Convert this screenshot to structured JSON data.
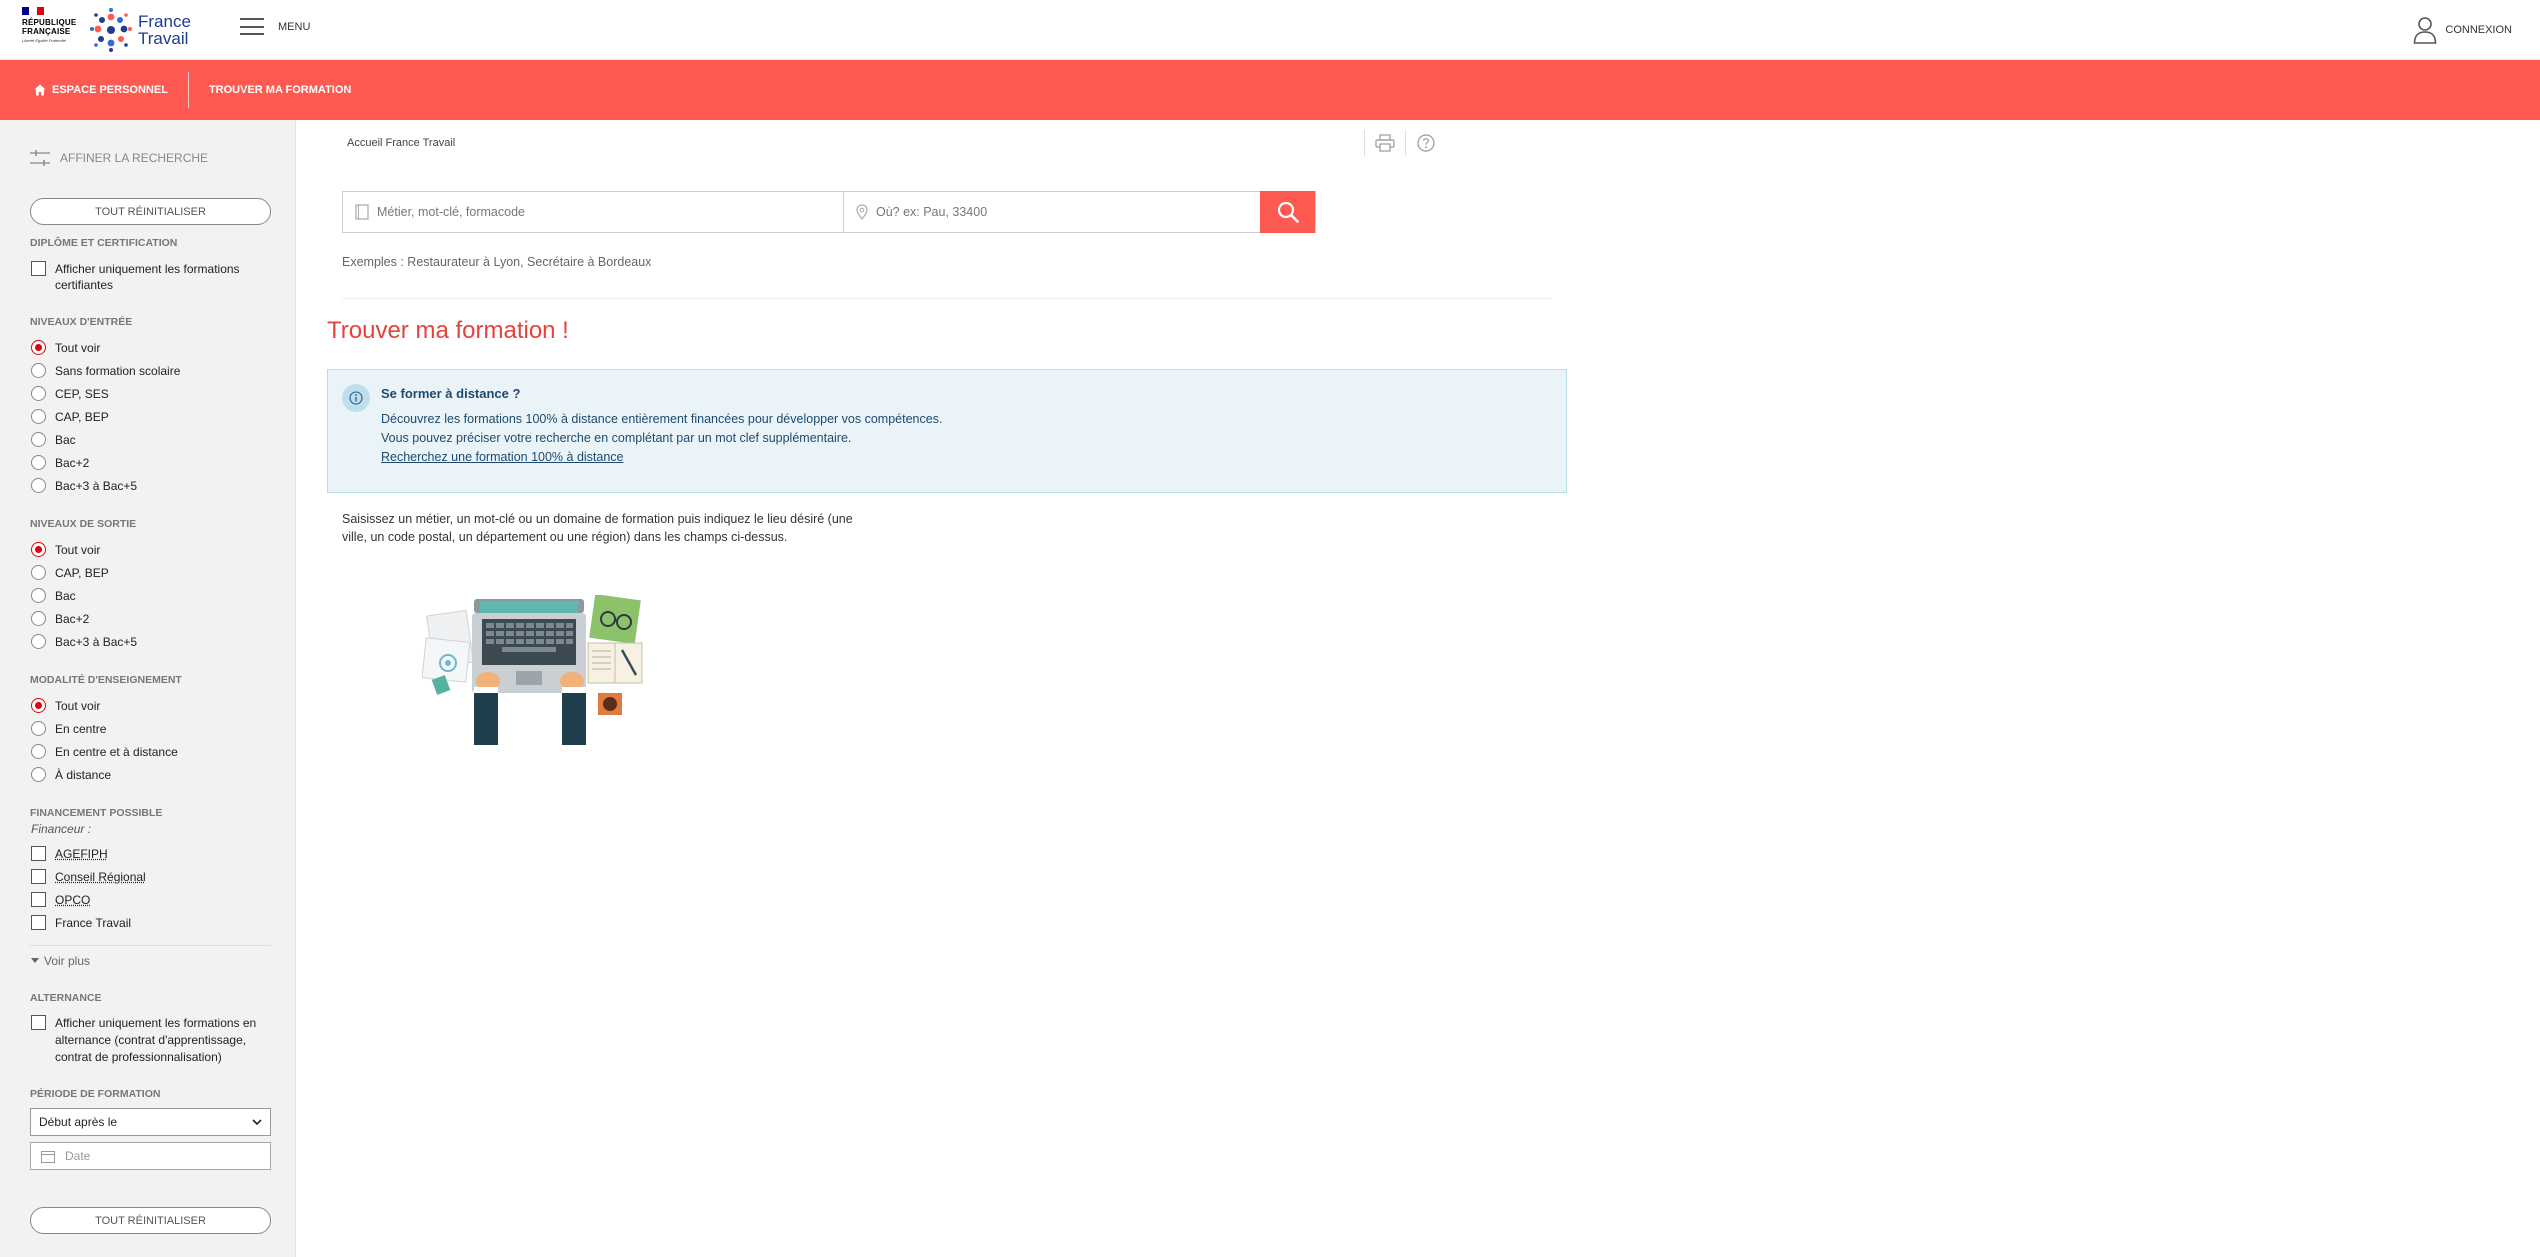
{
  "header": {
    "rf_logo_lines": [
      "RÉPUBLIQUE",
      "FRANÇAISE"
    ],
    "rf_motto": "Liberté Égalité Fraternité",
    "brand_line1": "France",
    "brand_line2": "Travail",
    "menu_label": "MENU",
    "menu_icon": "hamburger-icon",
    "connexion_label": "CONNEXION",
    "connexion_icon": "user-icon"
  },
  "nav": {
    "espace_personnel": "ESPACE PERSONNEL",
    "trouver_formation": "TROUVER MA FORMATION",
    "home_icon": "home-icon",
    "bg_color": "#ff5a52"
  },
  "sidebar": {
    "affiner": "AFFINER LA RECHERCHE",
    "reset_label": "TOUT RÉINITIALISER",
    "diplome": {
      "title": "DIPLÔME ET CERTIFICATION",
      "option": "Afficher uniquement les formations certifiantes"
    },
    "niveaux_entree": {
      "title": "NIVEAUX D'ENTRÉE",
      "options": [
        "Tout voir",
        "Sans formation scolaire",
        "CEP, SES",
        "CAP, BEP",
        "Bac",
        "Bac+2",
        "Bac+3 à Bac+5"
      ],
      "selected": "Tout voir"
    },
    "niveaux_sortie": {
      "title": "NIVEAUX DE SORTIE",
      "options": [
        "Tout voir",
        "CAP, BEP",
        "Bac",
        "Bac+2",
        "Bac+3 à Bac+5"
      ],
      "selected": "Tout voir"
    },
    "modalite": {
      "title": "MODALITÉ D'ENSEIGNEMENT",
      "options": [
        "Tout voir",
        "En centre",
        "En centre et à distance",
        "À distance"
      ],
      "selected": "Tout voir"
    },
    "financement": {
      "title": "FINANCEMENT POSSIBLE",
      "subtitle": "Financeur :",
      "options": [
        "AGEFIPH",
        "Conseil Régional",
        "OPCO",
        "France Travail"
      ]
    },
    "voir_plus": "Voir plus",
    "alternance": {
      "title": "ALTERNANCE",
      "option_line1": "Afficher uniquement les formations en",
      "option_line2": "alternance (contrat d'apprentissage,",
      "option_line3": "contrat de professionnalisation)"
    },
    "periode": {
      "title": "PÉRIODE DE FORMATION",
      "select_value": "Début après le",
      "date_placeholder": "Date"
    }
  },
  "main": {
    "breadcrumb": "Accueil France Travail",
    "search": {
      "what_placeholder": "Métier, mot-clé, formacode",
      "where_placeholder": "Où? ex: Pau, 33400"
    },
    "examples": "Exemples : Restaurateur à Lyon, Secrétaire à Bordeaux",
    "title": "Trouver ma formation !",
    "info": {
      "title": "Se former à distance ?",
      "line1": "Découvrez les formations 100% à distance entièrement financées pour développer vos compétences.",
      "line2": "Vous pouvez préciser votre recherche en complétant par un mot clef supplémentaire.",
      "link": "Recherchez une formation 100% à distance"
    },
    "help_line1": "Saisissez un métier, un mot-clé ou un domaine de formation puis indiquez le lieu désiré (une",
    "help_line2": "ville, un code postal, un département ou une région) dans les champs ci-dessus."
  },
  "colors": {
    "accent": "#ff5a52",
    "title_red": "#e5433a",
    "radio_red": "#e1000f",
    "info_bg": "#eaf4f8",
    "brand_blue": "#1d3d8f"
  }
}
